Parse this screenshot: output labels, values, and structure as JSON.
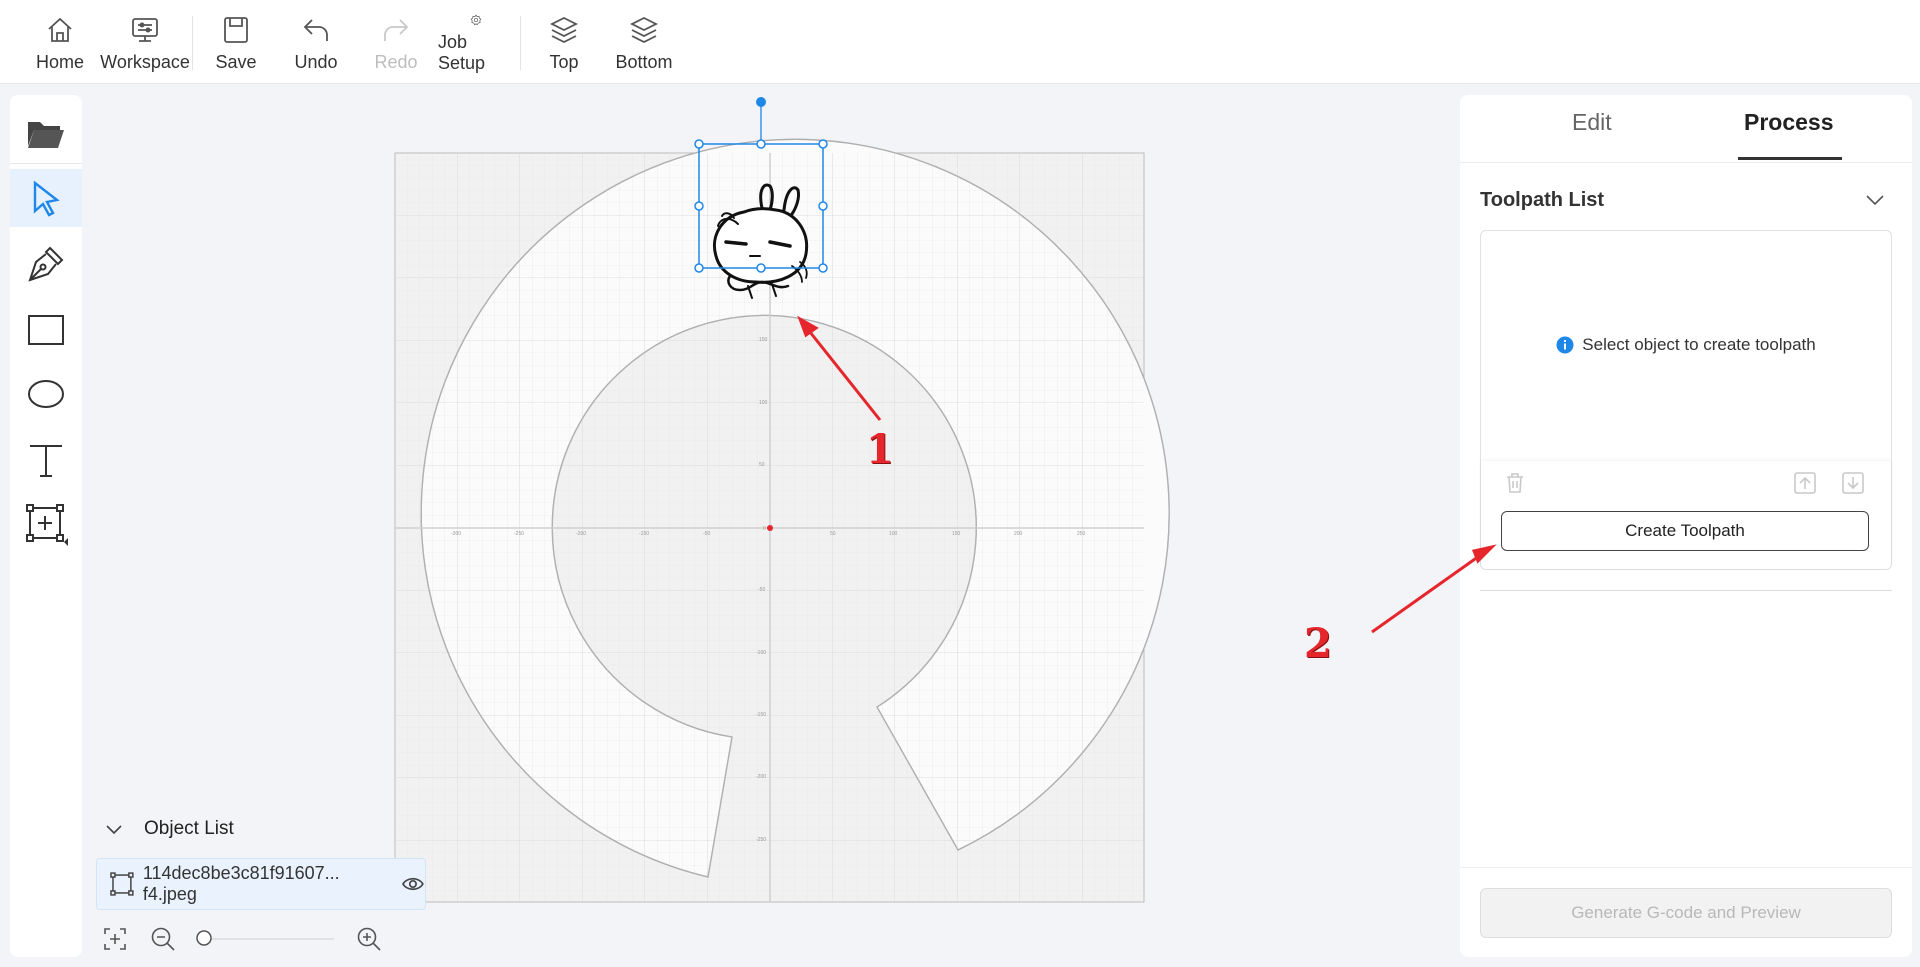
{
  "toolbar": {
    "home": "Home",
    "workspace": "Workspace",
    "save": "Save",
    "undo": "Undo",
    "redo": "Redo",
    "job_setup": "Job Setup",
    "top": "Top",
    "bottom": "Bottom"
  },
  "left_tools": [
    "folder-icon",
    "select-arrow-icon",
    "pen-icon",
    "rectangle-icon",
    "ellipse-icon",
    "text-icon",
    "add-frame-icon"
  ],
  "object_list": {
    "title": "Object List",
    "items": [
      {
        "name": "114dec8be3c81f91607... f4.jpeg"
      }
    ]
  },
  "panel": {
    "tabs": [
      "Edit",
      "Process"
    ],
    "active_tab": "Process",
    "toolpath_title": "Toolpath List",
    "empty_message": "Select object to create toolpath",
    "create_button": "Create Toolpath",
    "generate_button": "Generate G-code and Preview"
  },
  "annotations": [
    "1",
    "2"
  ],
  "colors": {
    "accent": "#1f87e8",
    "annotation": "#e5262c",
    "origin": "#e5262c"
  }
}
